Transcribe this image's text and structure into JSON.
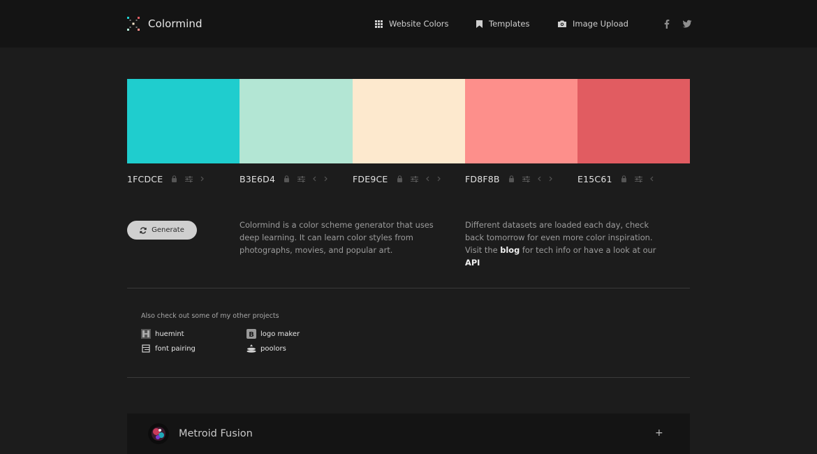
{
  "header": {
    "logo_text": "Colormind",
    "nav": [
      {
        "label": "Website Colors",
        "icon": "grid-icon"
      },
      {
        "label": "Templates",
        "icon": "bookmark-icon"
      },
      {
        "label": "Image Upload",
        "icon": "camera-icon"
      }
    ],
    "social": [
      "facebook-icon",
      "twitter-icon"
    ]
  },
  "palette": [
    {
      "hex": "1FCDCE",
      "color": "#1FCDCE"
    },
    {
      "hex": "B3E6D4",
      "color": "#B3E6D4"
    },
    {
      "hex": "FDE9CE",
      "color": "#FDE9CE"
    },
    {
      "hex": "FD8F8B",
      "color": "#FD8F8B"
    },
    {
      "hex": "E15C61",
      "color": "#E15C61"
    }
  ],
  "generate_label": "Generate",
  "intro": {
    "left": "Colormind is a color scheme generator that uses deep learning. It can learn color styles from photographs, movies, and popular art.",
    "right_prefix": "Different datasets are loaded each day, check back tomorrow for even more color inspiration. Visit the",
    "blog_link": "blog",
    "right_middle": "for tech info or have a look at our",
    "api_link": "API"
  },
  "projects": {
    "title": "Also check out some of my other projects",
    "items": [
      {
        "label": "huemint",
        "icon": "huemint-icon"
      },
      {
        "label": "logo maker",
        "icon": "logo-maker-icon"
      },
      {
        "label": "font pairing",
        "icon": "font-pairing-icon"
      },
      {
        "label": "poolors",
        "icon": "poolors-icon"
      }
    ]
  },
  "featured": {
    "title": "Metroid Fusion",
    "expand": "+"
  }
}
